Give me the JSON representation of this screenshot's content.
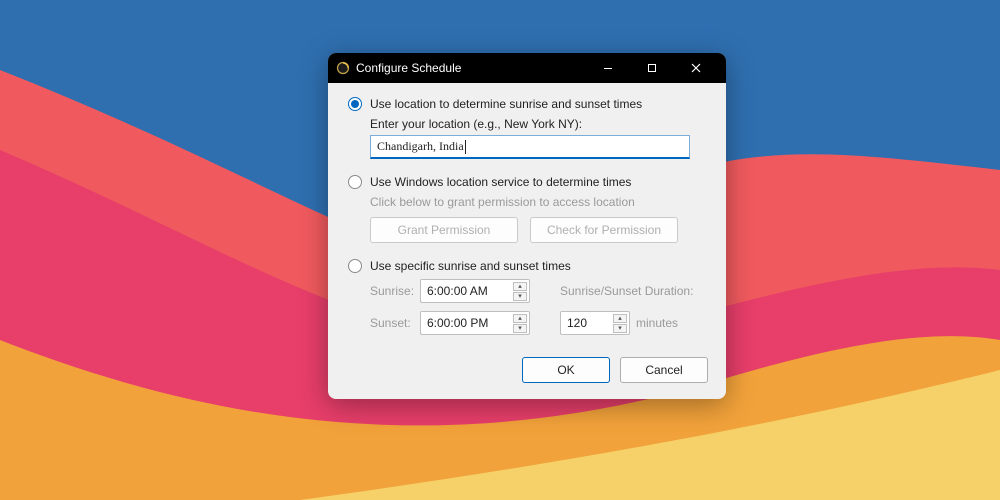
{
  "window": {
    "title": "Configure Schedule"
  },
  "opt1": {
    "label": "Use location to determine sunrise and sunset times",
    "prompt": "Enter your location (e.g., New York NY):",
    "value": "Chandigarh, India"
  },
  "opt2": {
    "label": "Use Windows location service to determine times",
    "hint": "Click below to grant permission to access location",
    "grant": "Grant Permission",
    "check": "Check for Permission"
  },
  "opt3": {
    "label": "Use specific sunrise and sunset times",
    "sunrise_label": "Sunrise:",
    "sunrise_value": "6:00:00 AM",
    "sunset_label": "Sunset:",
    "sunset_value": "6:00:00 PM",
    "duration_label": "Sunrise/Sunset Duration:",
    "duration_value": "120",
    "minutes_label": "minutes"
  },
  "footer": {
    "ok": "OK",
    "cancel": "Cancel"
  }
}
